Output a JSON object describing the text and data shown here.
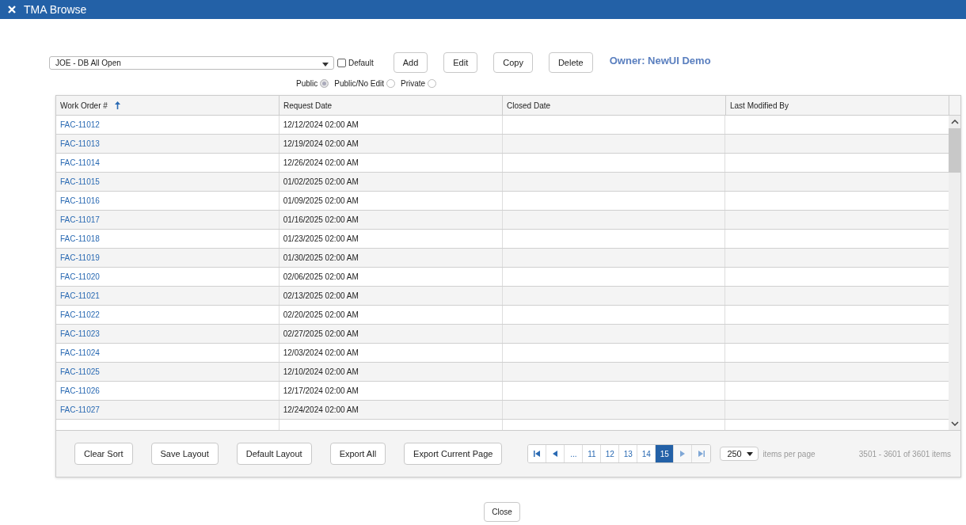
{
  "window": {
    "title": "TMA Browse"
  },
  "layout_select": {
    "value": "JOE - DB All Open"
  },
  "default_checkbox": {
    "label": "Default",
    "checked": false
  },
  "toolbar_buttons": [
    "Add",
    "Edit",
    "Copy",
    "Delete"
  ],
  "owner": "Owner: NewUI Demo",
  "visibility": [
    {
      "label": "Public",
      "selected": true
    },
    {
      "label": "Public/No Edit",
      "selected": false
    },
    {
      "label": "Private",
      "selected": false
    }
  ],
  "table": {
    "columns": [
      {
        "label": "Work Order #",
        "sorted": true
      },
      {
        "label": "Request Date",
        "sorted": false
      },
      {
        "label": "Closed Date",
        "sorted": false
      },
      {
        "label": "Last Modified By",
        "sorted": false
      }
    ],
    "rows": [
      [
        "FAC-11012",
        "12/12/2024 02:00 AM",
        "",
        ""
      ],
      [
        "FAC-11013",
        "12/19/2024 02:00 AM",
        "",
        ""
      ],
      [
        "FAC-11014",
        "12/26/2024 02:00 AM",
        "",
        ""
      ],
      [
        "FAC-11015",
        "01/02/2025 02:00 AM",
        "",
        ""
      ],
      [
        "FAC-11016",
        "01/09/2025 02:00 AM",
        "",
        ""
      ],
      [
        "FAC-11017",
        "01/16/2025 02:00 AM",
        "",
        ""
      ],
      [
        "FAC-11018",
        "01/23/2025 02:00 AM",
        "",
        ""
      ],
      [
        "FAC-11019",
        "01/30/2025 02:00 AM",
        "",
        ""
      ],
      [
        "FAC-11020",
        "02/06/2025 02:00 AM",
        "",
        ""
      ],
      [
        "FAC-11021",
        "02/13/2025 02:00 AM",
        "",
        ""
      ],
      [
        "FAC-11022",
        "02/20/2025 02:00 AM",
        "",
        ""
      ],
      [
        "FAC-11023",
        "02/27/2025 02:00 AM",
        "",
        ""
      ],
      [
        "FAC-11024",
        "12/03/2024 02:00 AM",
        "",
        ""
      ],
      [
        "FAC-11025",
        "12/10/2024 02:00 AM",
        "",
        ""
      ],
      [
        "FAC-11026",
        "12/17/2024 02:00 AM",
        "",
        ""
      ],
      [
        "FAC-11027",
        "12/24/2024 02:00 AM",
        "",
        ""
      ]
    ]
  },
  "footer_buttons": [
    "Clear Sort",
    "Save Layout",
    "Default Layout",
    "Export All",
    "Export Current Page"
  ],
  "pager": {
    "pages": [
      {
        "label": "...",
        "selected": false
      },
      {
        "label": "11",
        "selected": false
      },
      {
        "label": "12",
        "selected": false
      },
      {
        "label": "13",
        "selected": false
      },
      {
        "label": "14",
        "selected": false
      },
      {
        "label": "15",
        "selected": true
      }
    ],
    "page_size": "250",
    "page_size_label": "items per page",
    "summary": "3501 - 3601 of 3601 items"
  },
  "close_button": "Close"
}
